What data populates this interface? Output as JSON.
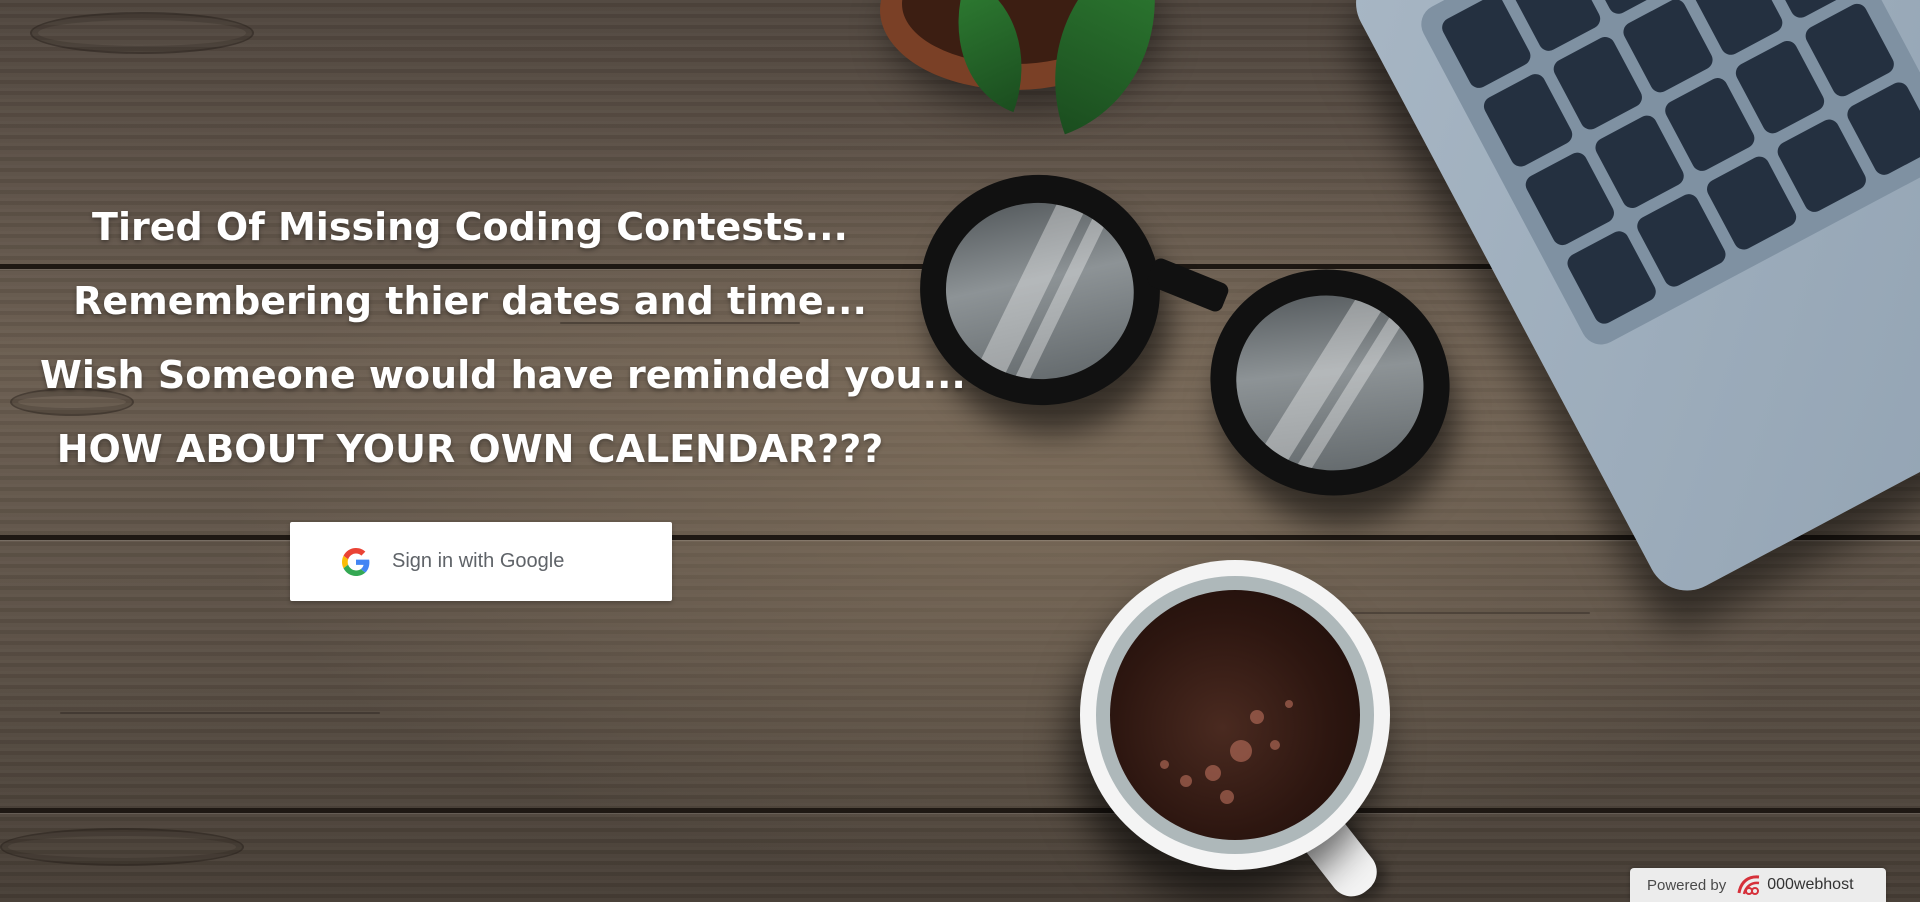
{
  "hero": {
    "line1": "Tired Of Missing Coding Contests...",
    "line2": "Remembering thier dates and time...",
    "line3": "Wish Someone would have reminded you...",
    "line4": "HOW ABOUT YOUR OWN CALENDAR???"
  },
  "signin": {
    "label": "Sign in with Google",
    "icon": "google-g-icon"
  },
  "badge": {
    "powered_label": "Powered by",
    "host_name": "000webhost",
    "icon": "000webhost-logo"
  },
  "colors": {
    "text": "#ffffff",
    "button_bg": "#ffffff",
    "button_text": "#5f6368",
    "google_blue": "#4285F4",
    "google_red": "#EA4335",
    "google_yellow": "#FBBC05",
    "google_green": "#34A853",
    "host_red": "#d6303a"
  }
}
